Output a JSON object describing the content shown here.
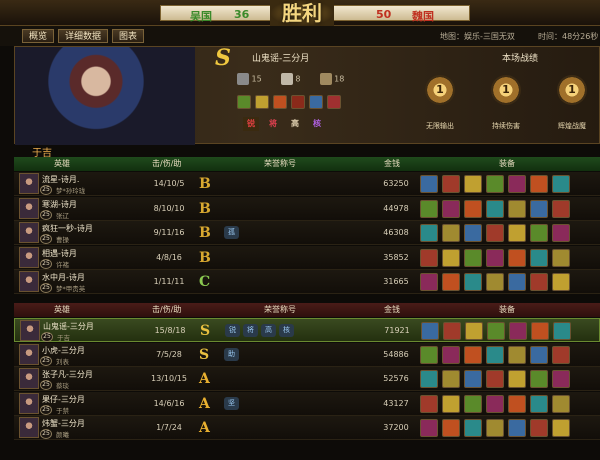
{
  "banner": {
    "team_left": "吴国",
    "score_left": "36",
    "victory": "胜利",
    "score_right": "50",
    "team_right": "魏国"
  },
  "tabs": [
    "概览",
    "详细数据",
    "图表"
  ],
  "meta": {
    "map": "地图：娱乐-三国无双",
    "time": "时间：48分26秒"
  },
  "hero": {
    "grade": "S",
    "name": "山鬼谣-三分月",
    "kills": "15",
    "deaths": "8",
    "assists": "18",
    "honors": [
      "锐",
      "将",
      "高",
      "核"
    ]
  },
  "record": {
    "title": "本场战绩",
    "medals": [
      {
        "label": "无限输出",
        "text": "1"
      },
      {
        "label": "持续伤害",
        "text": "1"
      },
      {
        "label": "辉煌战魔",
        "text": "1"
      }
    ]
  },
  "player_label": "于吉",
  "columns": {
    "hero": "英雄",
    "kda": "击/伤/助",
    "honor": "荣誉称号",
    "gold": "金钱",
    "equip": "装备"
  },
  "team_a": [
    {
      "name": "流星-诗月.",
      "sub": "梦*孙玲珑",
      "lvl": "25",
      "kda": "14/10/5",
      "rank": "B",
      "gold": "63250",
      "badge": ""
    },
    {
      "name": "寒湖-诗月",
      "sub": "张辽",
      "lvl": "25",
      "kda": "8/10/10",
      "rank": "B",
      "gold": "44978",
      "badge": ""
    },
    {
      "name": "疯狂一秒-诗月",
      "sub": "曹操",
      "lvl": "25",
      "kda": "9/11/16",
      "rank": "B",
      "gold": "46308",
      "badge": "孤"
    },
    {
      "name": "相遇-诗月",
      "sub": "许褚",
      "lvl": "25",
      "kda": "4/8/16",
      "rank": "B",
      "gold": "35852",
      "badge": ""
    },
    {
      "name": "水中月-诗月",
      "sub": "梦*甲贵英",
      "lvl": "25",
      "kda": "1/11/11",
      "rank": "C",
      "gold": "31665",
      "badge": ""
    }
  ],
  "team_b": [
    {
      "name": "山鬼谣-三分月",
      "sub": "于吉",
      "lvl": "25",
      "kda": "15/8/18",
      "rank": "S",
      "gold": "71921",
      "badges": [
        "锐",
        "将",
        "高",
        "核"
      ],
      "hl": true
    },
    {
      "name": "小虎-三分月",
      "sub": "刘表",
      "lvl": "25",
      "kda": "7/5/28",
      "rank": "S",
      "gold": "54886",
      "badges": [
        "助"
      ]
    },
    {
      "name": "张子凡-三分月",
      "sub": "蔡琰",
      "lvl": "25",
      "kda": "13/10/15",
      "rank": "A",
      "gold": "52576",
      "badges": []
    },
    {
      "name": "果仔-三分月",
      "sub": "于禁",
      "lvl": "25",
      "kda": "14/6/16",
      "rank": "A",
      "gold": "43127",
      "badges": [
        "坚"
      ]
    },
    {
      "name": "炜蟹-三分月",
      "sub": "颜曦",
      "lvl": "25",
      "kda": "1/7/24",
      "rank": "A",
      "gold": "37200",
      "badges": []
    }
  ],
  "colors": {
    "S": "#e8c040",
    "A": "#e8b030",
    "B": "#d8a830",
    "C": "#8ac850",
    "green_header": "#1f4a1c",
    "red_header": "#4a1c18"
  },
  "icons": [
    "sword-icon",
    "skull-icon",
    "fist-icon"
  ]
}
